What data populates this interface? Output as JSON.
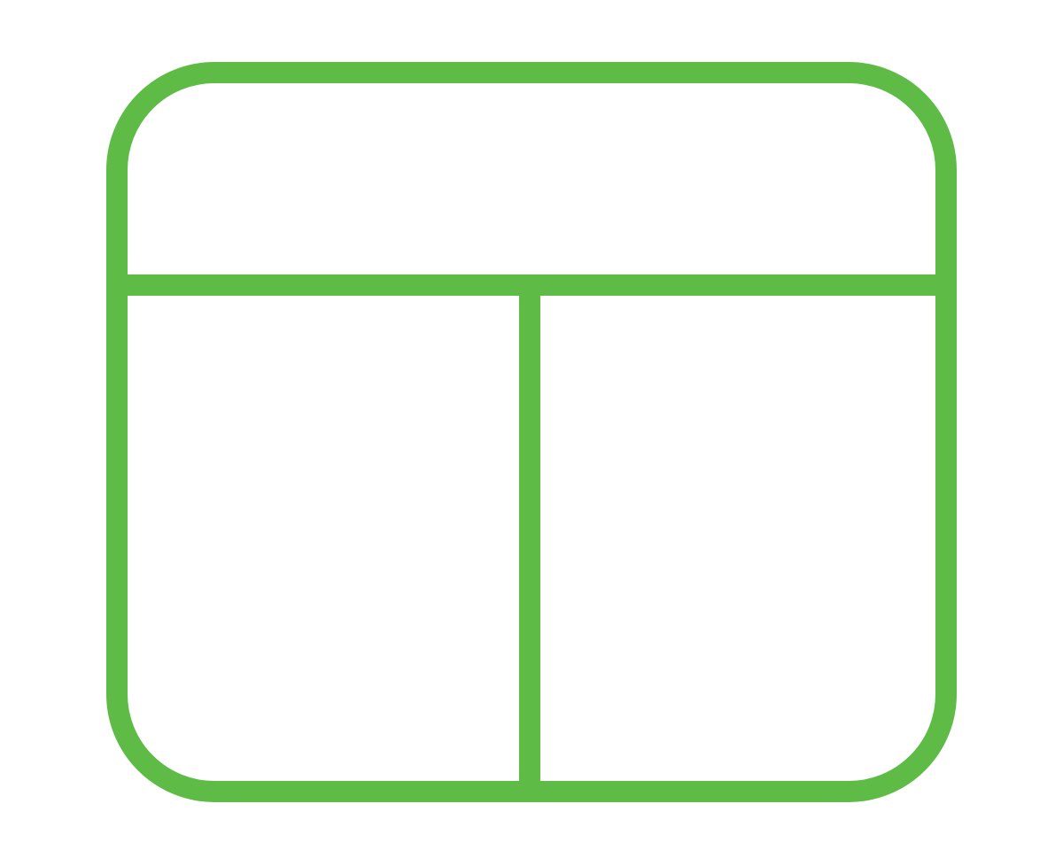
{
  "icon": {
    "name": "layout-panels-icon",
    "color": "#5DBB46"
  }
}
